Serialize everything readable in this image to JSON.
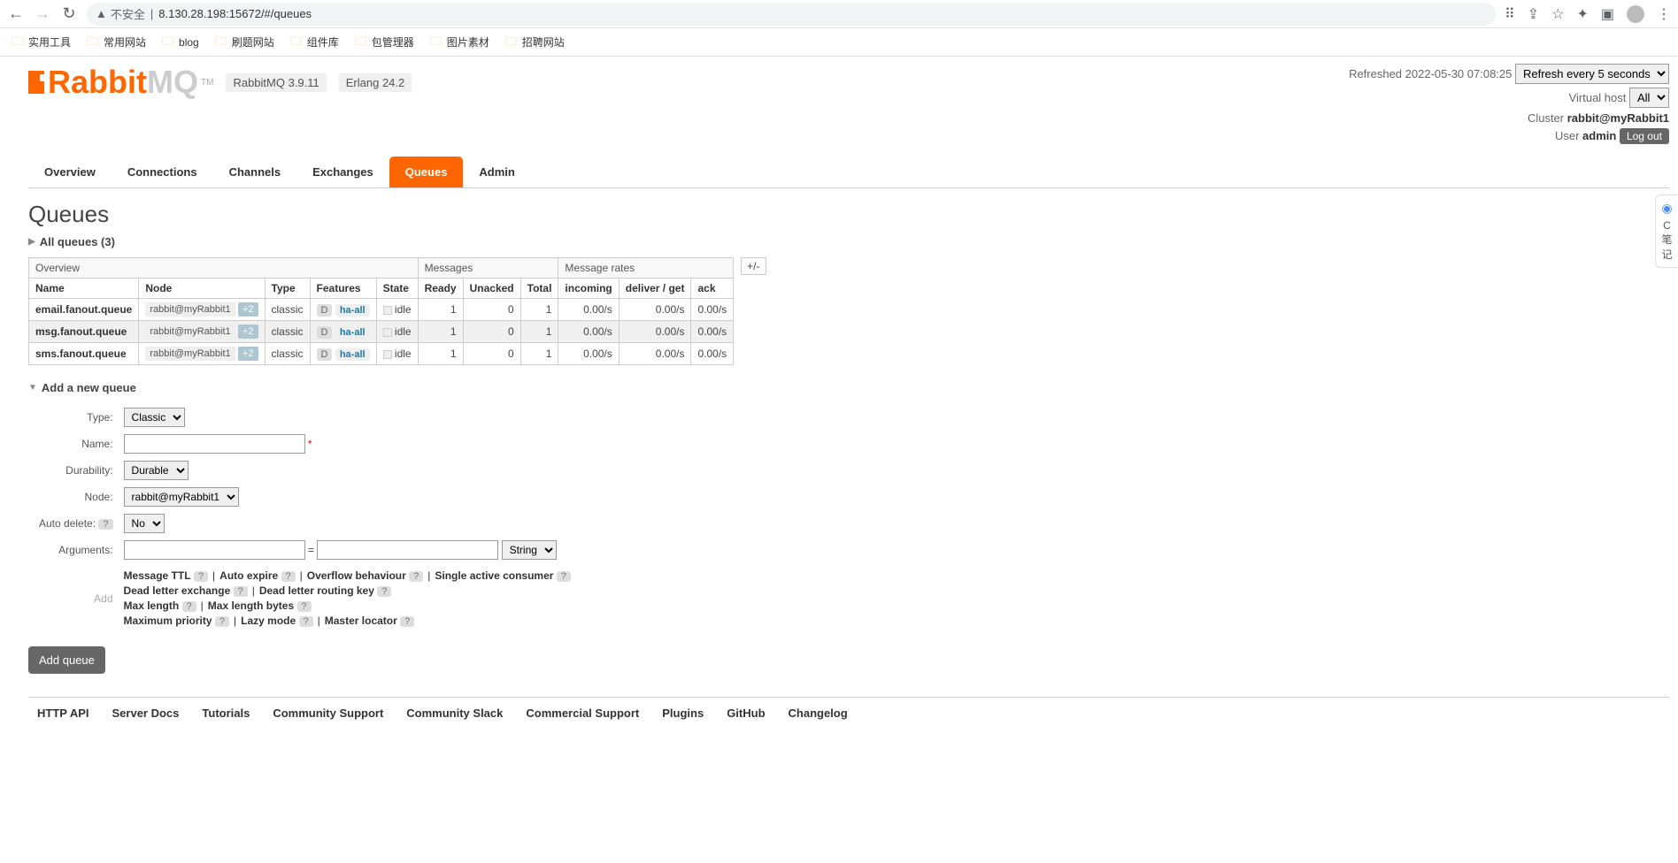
{
  "browser": {
    "url_insecure": "不安全",
    "url": "8.130.28.198:15672/#/queues",
    "bookmarks": [
      "实用工具",
      "常用网站",
      "blog",
      "刷题网站",
      "组件库",
      "包管理器",
      "图片素材",
      "招聘网站"
    ]
  },
  "logoText": "Rabbit",
  "logoMQ": "MQ",
  "tm": "TM",
  "versionTag": "RabbitMQ 3.9.11",
  "erlangTag": "Erlang 24.2",
  "headerRight": {
    "refreshed": "Refreshed 2022-05-30 07:08:25",
    "refreshSelect": "Refresh every 5 seconds",
    "vhostLabel": "Virtual host",
    "vhostSelect": "All",
    "clusterLabel": "Cluster",
    "clusterName": "rabbit@myRabbit1",
    "userLabel": "User",
    "userName": "admin",
    "logout": "Log out"
  },
  "tabs": [
    "Overview",
    "Connections",
    "Channels",
    "Exchanges",
    "Queues",
    "Admin"
  ],
  "activeTab": 4,
  "pageTitle": "Queues",
  "allQueues": "All queues (3)",
  "addCol": "+/-",
  "tableGroups": [
    "Overview",
    "Messages",
    "Message rates"
  ],
  "tableCols": [
    "Name",
    "Node",
    "Type",
    "Features",
    "State",
    "Ready",
    "Unacked",
    "Total",
    "incoming",
    "deliver / get",
    "ack"
  ],
  "rows": [
    {
      "name": "email.fanout.queue",
      "node": "rabbit@myRabbit1",
      "plus": "+2",
      "type": "classic",
      "featD": "D",
      "featHA": "ha-all",
      "state": "idle",
      "ready": "1",
      "unacked": "0",
      "total": "1",
      "incoming": "0.00/s",
      "deliver": "0.00/s",
      "ack": "0.00/s"
    },
    {
      "name": "msg.fanout.queue",
      "node": "rabbit@myRabbit1",
      "plus": "+2",
      "type": "classic",
      "featD": "D",
      "featHA": "ha-all",
      "state": "idle",
      "ready": "1",
      "unacked": "0",
      "total": "1",
      "incoming": "0.00/s",
      "deliver": "0.00/s",
      "ack": "0.00/s"
    },
    {
      "name": "sms.fanout.queue",
      "node": "rabbit@myRabbit1",
      "plus": "+2",
      "type": "classic",
      "featD": "D",
      "featHA": "ha-all",
      "state": "idle",
      "ready": "1",
      "unacked": "0",
      "total": "1",
      "incoming": "0.00/s",
      "deliver": "0.00/s",
      "ack": "0.00/s"
    }
  ],
  "addSection": "Add a new queue",
  "form": {
    "typeLabel": "Type:",
    "typeVal": "Classic",
    "nameLabel": "Name:",
    "nameVal": "",
    "mand": "*",
    "durLabel": "Durability:",
    "durVal": "Durable",
    "nodeLabel": "Node:",
    "nodeVal": "rabbit@myRabbit1",
    "autoDeleteLabel": "Auto delete:",
    "autoDeleteVal": "No",
    "argsLabel": "Arguments:",
    "argsKey": "",
    "argsEq": "=",
    "argsVal": "",
    "argsType": "String",
    "addLabel": "Add",
    "help": "?",
    "helpers": [
      [
        "Message TTL",
        "Auto expire",
        "Overflow behaviour",
        "Single active consumer"
      ],
      [
        "Dead letter exchange",
        "Dead letter routing key"
      ],
      [
        "Max length",
        "Max length bytes"
      ],
      [
        "Maximum priority",
        "Lazy mode",
        "Master locator"
      ]
    ],
    "submit": "Add queue"
  },
  "footer": [
    "HTTP API",
    "Server Docs",
    "Tutorials",
    "Community Support",
    "Community Slack",
    "Commercial Support",
    "Plugins",
    "GitHub",
    "Changelog"
  ],
  "sidePanel": {
    "c": "C",
    "text": "笔记"
  }
}
